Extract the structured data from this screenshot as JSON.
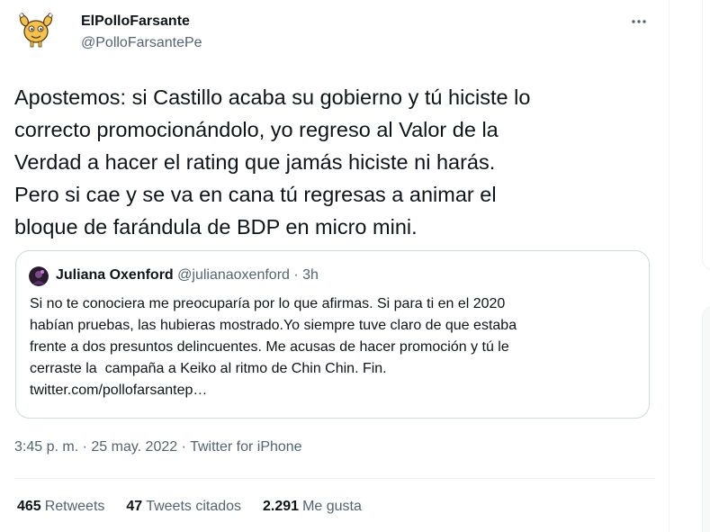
{
  "tweet": {
    "author_name": "ElPolloFarsante",
    "author_handle": "@PolloFarsantePe",
    "text": "Apostemos: si Castillo acaba su gobierno y tú hiciste lo\ncorrecto promocionándolo, yo regreso al Valor de la\nVerdad a hacer el rating que jamás hiciste ni harás.\nPero si cae y se va en cana tú regresas a animar el\nbloque de farándula de BDP en micro mini.",
    "avatar_icon": "chicken-avatar-icon",
    "more_icon": "more-dots-icon"
  },
  "quote": {
    "author_name": "Juliana Oxenford",
    "author_handle": "@julianaoxenford",
    "separator": "·",
    "time": "3h",
    "text": "Si no te conociera me preocuparía por lo que afirmas. Si para ti en el 2020\nhabían pruebas, las hubieras mostrado.Yo siempre tuve claro de que estaba\nfrente a dos presuntos delincuentes. Me acusas de hacer promoción y tú le\ncerraste la  campaña a Keiko al ritmo de Chin Chin. Fin.\ntwitter.com/pollofarsantep…",
    "avatar_icon": "quote-author-avatar-icon"
  },
  "meta": {
    "time": "3:45 p. m.",
    "separator1": " · ",
    "date": "25 may. 2022",
    "separator2": " · ",
    "source": "Twitter for iPhone"
  },
  "stats": {
    "retweets_count": "465",
    "retweets_label": "Retweets",
    "quotes_count": "47",
    "quotes_label": "Tweets citados",
    "likes_count": "2.291",
    "likes_label": "Me gusta"
  },
  "colors": {
    "text_primary": "#0f1419",
    "text_secondary": "#536471",
    "border": "#cfd9de",
    "divider": "#eff3f4"
  }
}
